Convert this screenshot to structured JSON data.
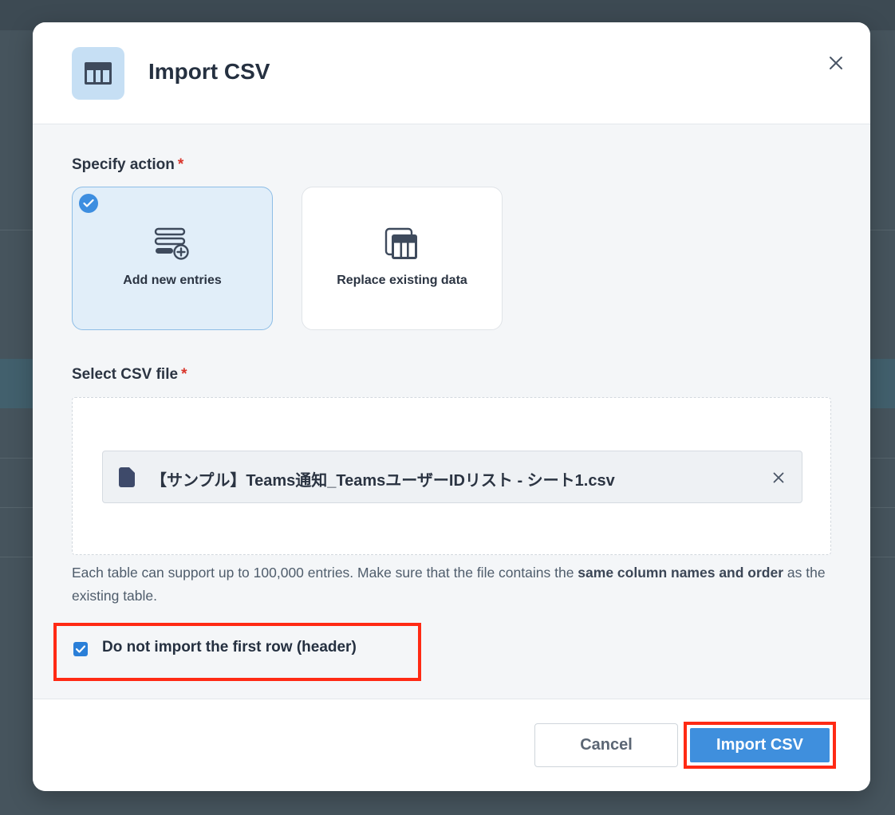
{
  "modal": {
    "title": "Import CSV",
    "icon": "table-icon"
  },
  "action_section": {
    "label": "Specify action",
    "required_mark": "*",
    "options": [
      {
        "label": "Add new entries",
        "icon": "add-entries-icon",
        "selected": true
      },
      {
        "label": "Replace existing data",
        "icon": "replace-table-icon",
        "selected": false
      }
    ]
  },
  "file_section": {
    "label": "Select CSV file",
    "required_mark": "*",
    "file_name": "【サンプル】Teams通知_TeamsユーザーIDリスト - シート1.csv"
  },
  "hint": {
    "text_before": "Each table can support up to 100,000 entries. Make sure that the file contains the ",
    "bold_text": "same column names and order",
    "text_after": " as the existing table."
  },
  "header_option": {
    "label": "Do not import the first row (header)",
    "checked": true
  },
  "footer": {
    "cancel_label": "Cancel",
    "import_label": "Import CSV"
  },
  "colors": {
    "accent": "#3f8fdd",
    "highlight": "#ff2a14",
    "selected_card": "#e1eef9"
  }
}
